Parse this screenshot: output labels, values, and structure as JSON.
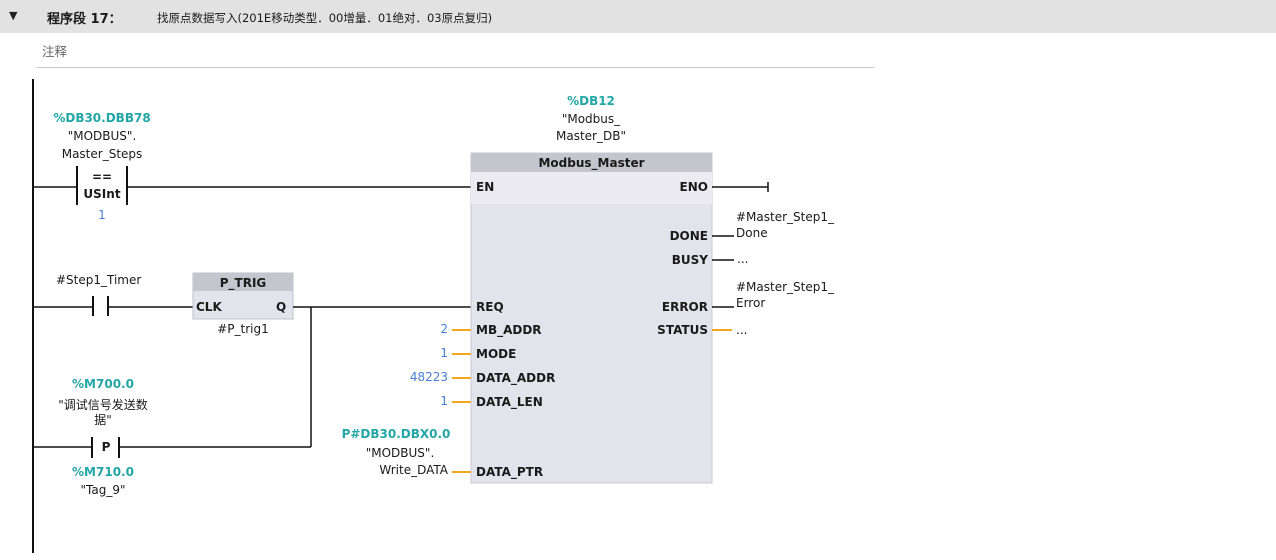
{
  "header": {
    "segment_label": "程序段 17：",
    "segment_title": "找原点数据写入(201E移动类型．00增量．01绝对．03原点复归)",
    "comment_placeholder": "注释"
  },
  "compare": {
    "address": "%DB30.DBB78",
    "tag_line1": "\"MODBUS\".",
    "tag_line2": "Master_Steps",
    "operator": "==",
    "type": "USInt",
    "value": "1"
  },
  "timer_contact": {
    "tag": "#Step1_Timer"
  },
  "ptrig": {
    "name": "P_TRIG",
    "clk": "CLK",
    "q": "Q",
    "instance": "#P_trig1"
  },
  "pcontact": {
    "address": "%M700.0",
    "tag_line1": "\"调试信号发送数",
    "tag_line2": "据\"",
    "symbol": "P",
    "edge_address": "%M710.0",
    "edge_tag": "\"Tag_9\""
  },
  "block": {
    "instance_address": "%DB12",
    "instance_line1": "\"Modbus_",
    "instance_line2": "Master_DB\"",
    "name": "Modbus_Master",
    "inputs": [
      {
        "name": "EN",
        "value": ""
      },
      {
        "name": "REQ",
        "value": ""
      },
      {
        "name": "MB_ADDR",
        "value": "2"
      },
      {
        "name": "MODE",
        "value": "1"
      },
      {
        "name": "DATA_ADDR",
        "value": "48223"
      },
      {
        "name": "DATA_LEN",
        "value": "1"
      },
      {
        "name": "DATA_PTR",
        "address": "P#DB30.DBX0.0",
        "line1": "\"MODBUS\".",
        "line2": "Write_DATA"
      }
    ],
    "outputs": [
      {
        "name": "ENO",
        "value": ""
      },
      {
        "name": "DONE",
        "value": "#Master_Step1_",
        "value2": "Done"
      },
      {
        "name": "BUSY",
        "value": "..."
      },
      {
        "name": "ERROR",
        "value": "#Master_Step1_",
        "value2": "Error"
      },
      {
        "name": "STATUS",
        "value": "..."
      }
    ]
  },
  "colors": {
    "header_bg": "#e2e2e2",
    "block_bg": "#e3e3ec",
    "block_header": "#c5c5cd",
    "address": "#23a6a6",
    "constant": "#4a7fd6",
    "pin": "#f4a71e"
  }
}
